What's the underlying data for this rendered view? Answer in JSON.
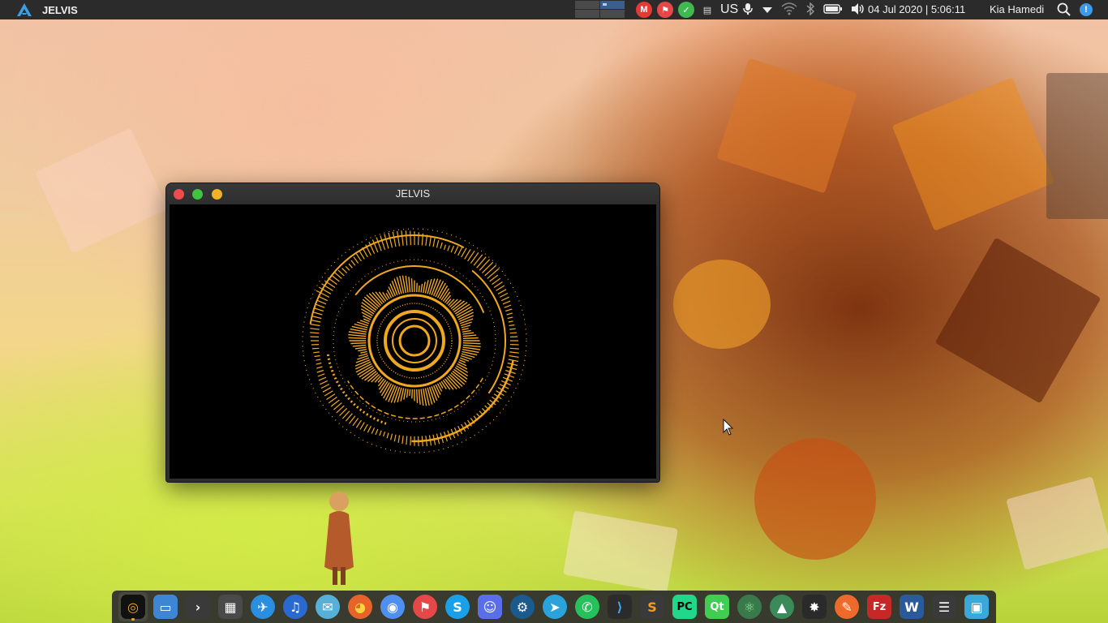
{
  "topbar": {
    "app_logo_icon": "arc-logo-icon",
    "app_name": "JELVIS",
    "workspaces": [
      {
        "active": false
      },
      {
        "active": true
      },
      {
        "active": false
      },
      {
        "active": false
      }
    ],
    "tray_icons": [
      {
        "name": "gmail-icon",
        "color": "#e53935",
        "glyph": "M"
      },
      {
        "name": "phone-indicator-icon",
        "color": "#e64848",
        "glyph": "⚑"
      },
      {
        "name": "check-sync-icon",
        "color": "#3fb950",
        "glyph": "✓"
      },
      {
        "name": "clipboard-icon",
        "color": "#dddddd",
        "glyph": "▤"
      }
    ],
    "keyboard_layout": "US",
    "status_icons": [
      "microphone-icon",
      "menu-arrow-icon",
      "wifi-icon",
      "bluetooth-icon",
      "battery-icon",
      "volume-icon"
    ],
    "clock": "04 Jul 2020 | 5:06:11",
    "user": "Kia Hamedi",
    "notification_badge": "!"
  },
  "window": {
    "title": "JELVIS",
    "visualizer_color": "#f0a820"
  },
  "dock": {
    "items": [
      {
        "name": "jelvis-icon",
        "bg": "#111111",
        "glyph": "◎",
        "fg": "#f0a820",
        "running": true,
        "first": true
      },
      {
        "name": "files-icon",
        "bg": "#3d86d6",
        "glyph": "▭",
        "fg": "#ffffff",
        "running": false
      },
      {
        "name": "terminal-icon",
        "bg": "#3a3a3a",
        "glyph": "›",
        "fg": "#ffffff",
        "running": false
      },
      {
        "name": "calculator-icon",
        "bg": "#4a4a4a",
        "glyph": "▦",
        "fg": "#ffffff",
        "running": false
      },
      {
        "name": "airplane-icon",
        "bg": "#2a8fe0",
        "glyph": "✈",
        "fg": "#ffffff",
        "running": false,
        "round": true
      },
      {
        "name": "music-player-icon",
        "bg": "#2a6ad0",
        "glyph": "♫",
        "fg": "#ffffff",
        "running": false,
        "round": true
      },
      {
        "name": "mail-icon",
        "bg": "#56b0d8",
        "glyph": "✉",
        "fg": "#ffffff",
        "running": false,
        "round": true
      },
      {
        "name": "firefox-icon",
        "bg": "#e8632a",
        "glyph": "◕",
        "fg": "#ffd43b",
        "running": false,
        "round": true
      },
      {
        "name": "chromium-icon",
        "bg": "#4e8ff0",
        "glyph": "◉",
        "fg": "#ffffff",
        "running": false,
        "round": true
      },
      {
        "name": "indicator-app-icon",
        "bg": "#e64848",
        "glyph": "⚑",
        "fg": "#ffffff",
        "running": false,
        "round": true
      },
      {
        "name": "skype-icon",
        "bg": "#1aa0e8",
        "glyph": "S",
        "fg": "#ffffff",
        "running": false,
        "round": true
      },
      {
        "name": "discord-icon",
        "bg": "#5b6eea",
        "glyph": "☺",
        "fg": "#ffffff",
        "running": false
      },
      {
        "name": "steam-icon",
        "bg": "#1b5a8c",
        "glyph": "⚙",
        "fg": "#ffffff",
        "running": false,
        "round": true
      },
      {
        "name": "telegram-icon",
        "bg": "#2aa2dc",
        "glyph": "➤",
        "fg": "#ffffff",
        "running": false,
        "round": true
      },
      {
        "name": "whatsapp-icon",
        "bg": "#27c15c",
        "glyph": "✆",
        "fg": "#ffffff",
        "running": false,
        "round": true
      },
      {
        "name": "vscode-icon",
        "bg": "#2b2b2b",
        "glyph": "⟩",
        "fg": "#3ba7f0",
        "running": false
      },
      {
        "name": "sublime-text-icon",
        "bg": "#3a3a3a",
        "glyph": "S",
        "fg": "#f59b1f",
        "running": false
      },
      {
        "name": "pycharm-icon",
        "bg": "#21d789",
        "glyph": "PC",
        "fg": "#000000",
        "running": false
      },
      {
        "name": "qt-creator-icon",
        "bg": "#41cd52",
        "glyph": "Qt",
        "fg": "#ffffff",
        "running": false
      },
      {
        "name": "atom-icon",
        "bg": "#3a7a4a",
        "glyph": "⚛",
        "fg": "#8ee6a8",
        "running": false,
        "round": true
      },
      {
        "name": "android-studio-icon",
        "bg": "#3a8a5a",
        "glyph": "▲",
        "fg": "#ffffff",
        "running": false,
        "round": true
      },
      {
        "name": "network-tool-icon",
        "bg": "#2a2a2a",
        "glyph": "✸",
        "fg": "#ffffff",
        "running": false
      },
      {
        "name": "feather-editor-icon",
        "bg": "#ee6a2a",
        "glyph": "✎",
        "fg": "#ffffff",
        "running": false,
        "round": true
      },
      {
        "name": "filezilla-icon",
        "bg": "#c62828",
        "glyph": "Fz",
        "fg": "#ffffff",
        "running": false
      },
      {
        "name": "waveform-monitor-icon",
        "bg": "#2a5a9a",
        "glyph": "W",
        "fg": "#ffffff",
        "running": false
      },
      {
        "name": "settings-sliders-icon",
        "bg": "#3a3a3a",
        "glyph": "☰",
        "fg": "#ffffff",
        "running": false
      },
      {
        "name": "screenshot-tool-icon",
        "bg": "#3aa8d8",
        "glyph": "▣",
        "fg": "#ffffff",
        "running": false
      }
    ]
  }
}
